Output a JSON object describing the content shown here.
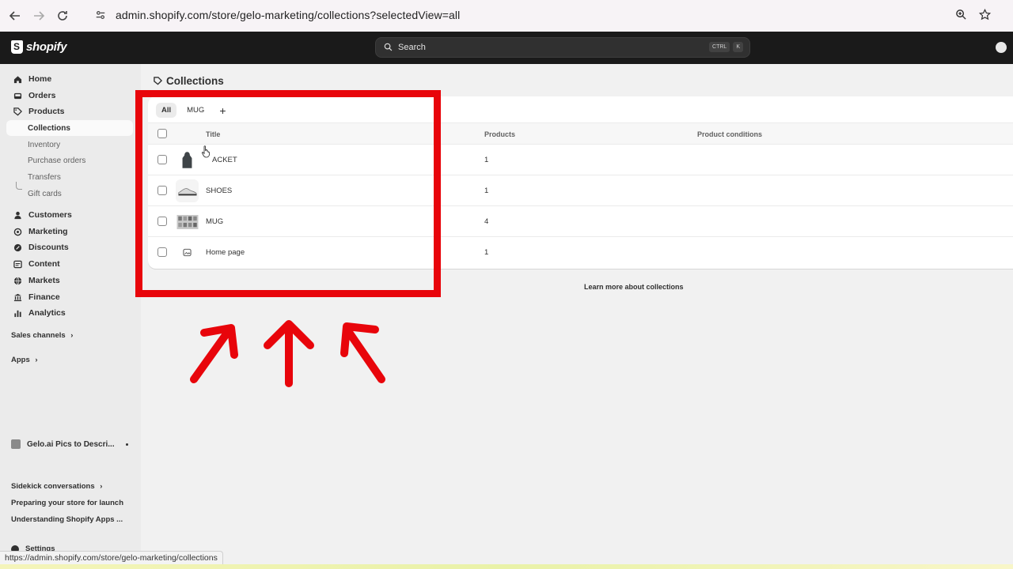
{
  "browser": {
    "url": "admin.shopify.com/store/gelo-marketing/collections?selectedView=all",
    "status_url": "https://admin.shopify.com/store/gelo-marketing/collections"
  },
  "topbar": {
    "brand": "shopify",
    "search_placeholder": "Search",
    "shortcut_ctrl": "CTRL",
    "shortcut_key": "K"
  },
  "sidebar": {
    "items": [
      {
        "label": "Home",
        "icon": "home-icon"
      },
      {
        "label": "Orders",
        "icon": "inbox-icon"
      },
      {
        "label": "Products",
        "icon": "tag-icon"
      }
    ],
    "product_sub": [
      "Collections",
      "Inventory",
      "Purchase orders",
      "Transfers",
      "Gift cards"
    ],
    "items2": [
      {
        "label": "Customers",
        "icon": "person-icon"
      },
      {
        "label": "Marketing",
        "icon": "target-icon"
      },
      {
        "label": "Discounts",
        "icon": "discount-icon"
      },
      {
        "label": "Content",
        "icon": "content-icon"
      },
      {
        "label": "Markets",
        "icon": "globe-icon"
      },
      {
        "label": "Finance",
        "icon": "bank-icon"
      },
      {
        "label": "Analytics",
        "icon": "chart-icon"
      }
    ],
    "sales_channels": "Sales channels",
    "apps": "Apps",
    "app_item": "Gelo.ai Pics to Descri...",
    "sidekick": "Sidekick conversations",
    "help1": "Preparing your store for launch",
    "help2": "Understanding Shopify Apps ...",
    "settings": "Settings"
  },
  "page": {
    "title": "Collections",
    "tabs": [
      "All",
      "MUG"
    ],
    "columns": {
      "title": "Title",
      "products": "Products",
      "conditions": "Product conditions"
    },
    "rows": [
      {
        "title": "JACKET",
        "title_visible": "ACKET",
        "count": "1"
      },
      {
        "title": "SHOES",
        "count": "1"
      },
      {
        "title": "MUG",
        "count": "4"
      },
      {
        "title": "Home page",
        "count": "1"
      }
    ],
    "learn_more": "Learn more about collections"
  },
  "colors": {
    "highlight": "#e8050b",
    "topbar": "#1a1a1a",
    "sidebar": "#ebebeb"
  }
}
